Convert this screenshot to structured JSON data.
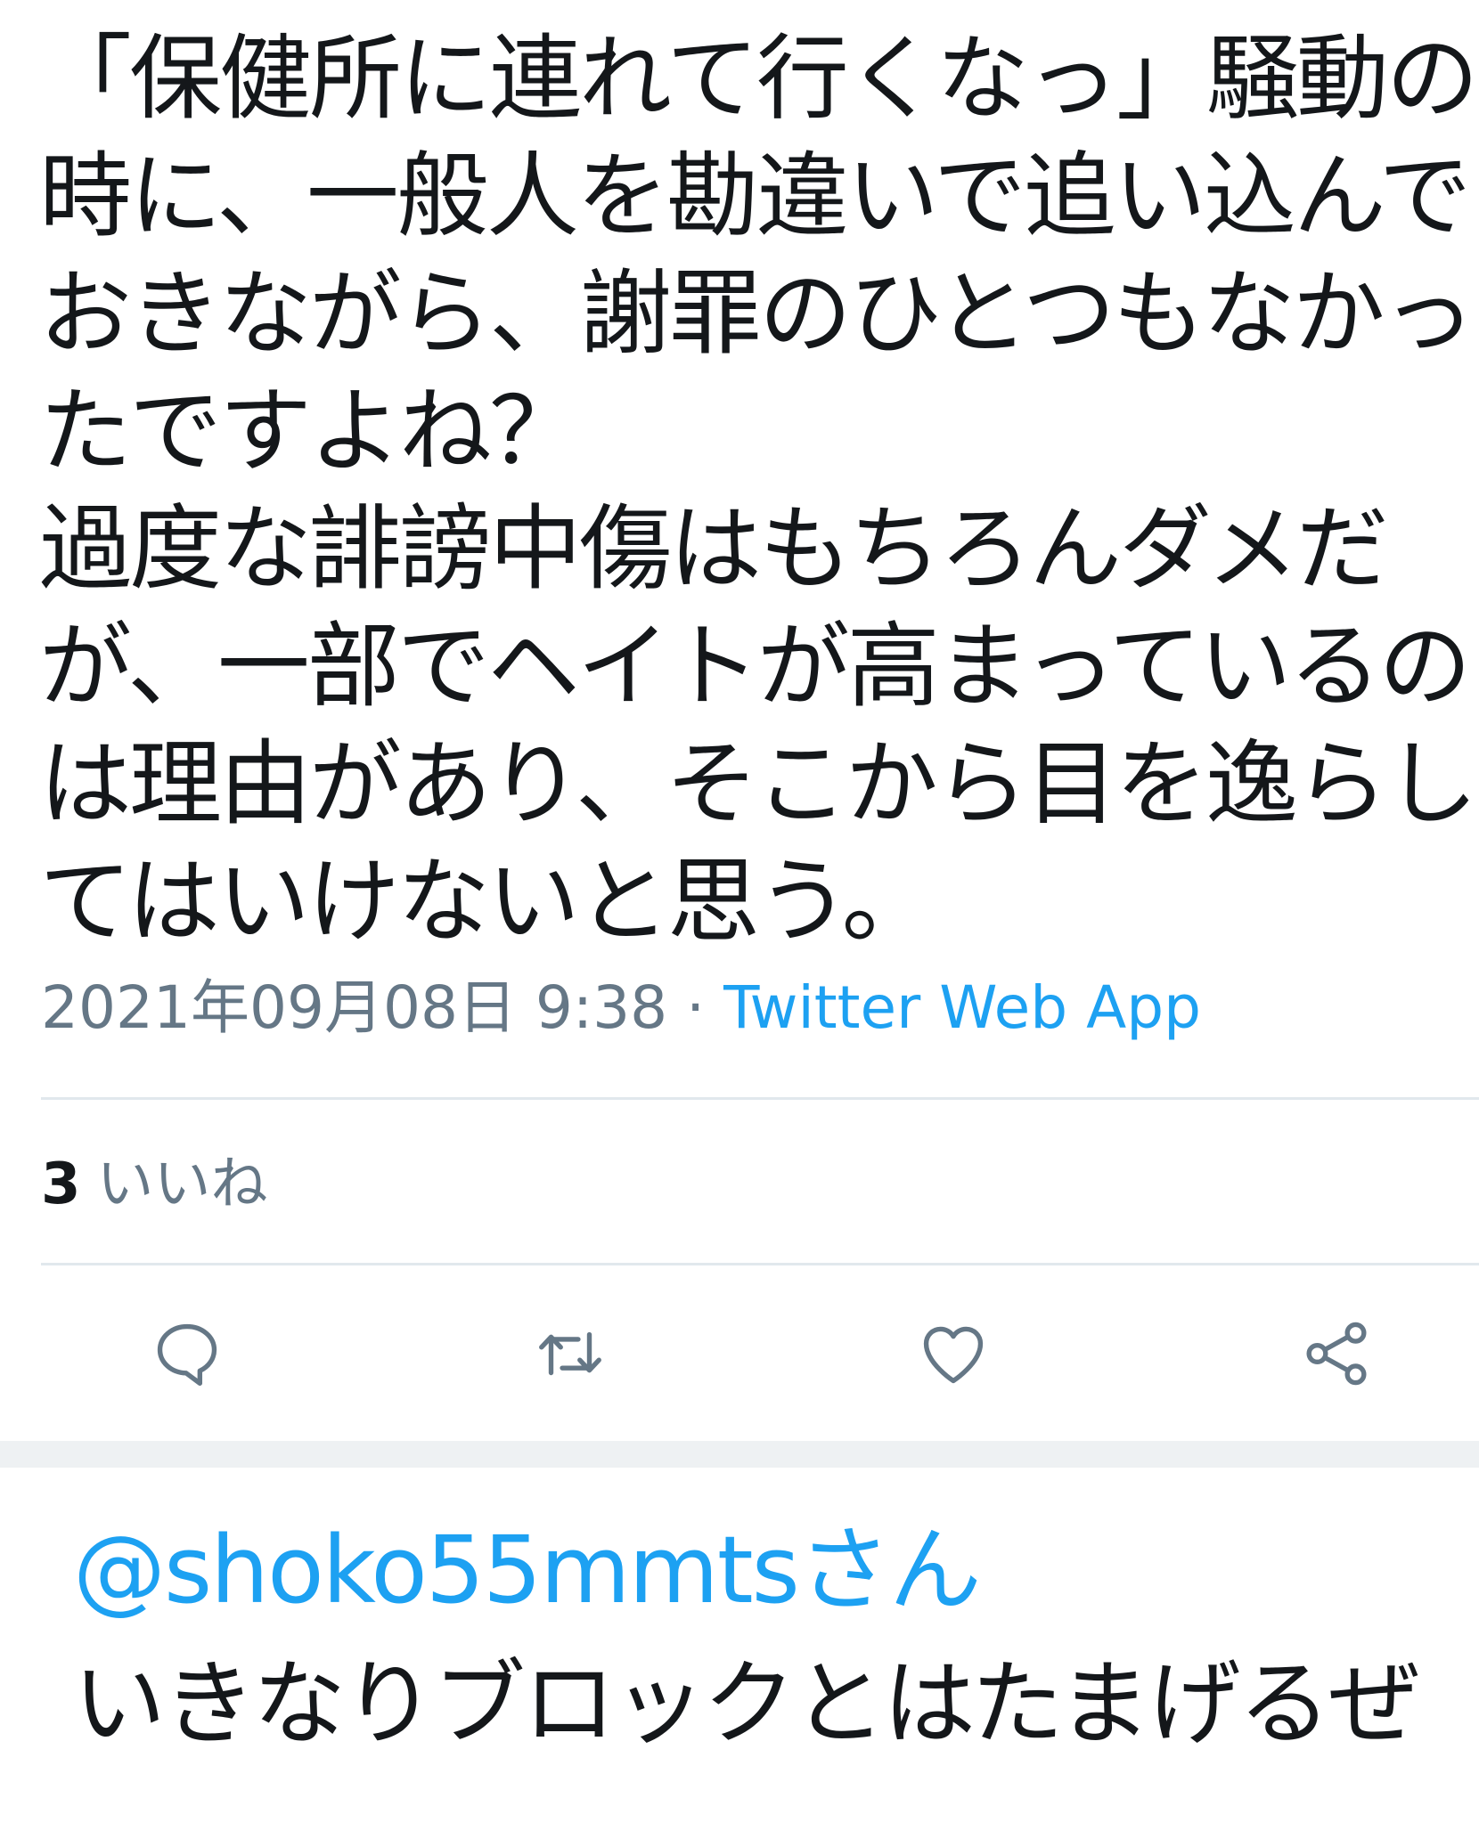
{
  "tweet": {
    "text_lines": [
      "「保健所に連れて行くなっ」騒動の",
      "時に、一般人を勘違いで追い込んで",
      "おきながら、謝罪のひとつもなかっ",
      "たですよね？",
      "過度な誹謗中傷はもちろんダメだ",
      "が、一部でヘイトが高まっているの",
      "は理由があり、そこから目を逸らし",
      "てはいけないと思う。"
    ],
    "timestamp": "2021年09月08日 9:38",
    "separator": " · ",
    "source": "Twitter Web App",
    "likes_count": "3",
    "likes_label": "いいね"
  },
  "actions": {
    "reply_icon": "comment-icon",
    "retweet_icon": "retweet-icon",
    "like_icon": "heart-icon",
    "share_icon": "share-icon",
    "icon_color": "#657786"
  },
  "reply": {
    "mention": "@shoko55mmtsさん",
    "text": "いきなりブロックとはたまげるぜ"
  },
  "colors": {
    "text": "#14171a",
    "secondary": "#657786",
    "link": "#1da1f2",
    "divider": "#e1e8ed"
  }
}
